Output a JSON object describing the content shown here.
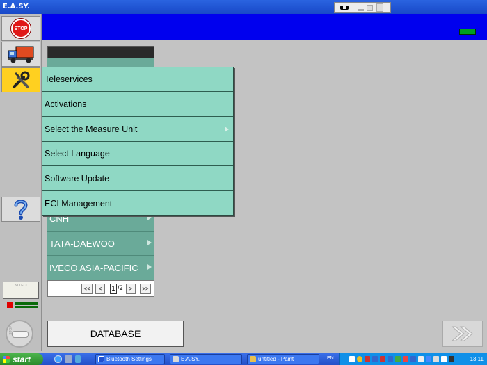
{
  "window": {
    "title": "E.A.SY."
  },
  "toolbar": {
    "stop_label": "STOP"
  },
  "menu": {
    "items": [
      {
        "label": "Teleservices",
        "submenu": false
      },
      {
        "label": "Activations",
        "submenu": false
      },
      {
        "label": "Select the Measure Unit",
        "submenu": true
      },
      {
        "label": "Select Language",
        "submenu": false
      },
      {
        "label": "Software Update",
        "submenu": false
      },
      {
        "label": "ECI Management",
        "submenu": false
      }
    ]
  },
  "brands": {
    "items": [
      {
        "label": "CNH"
      },
      {
        "label": "TATA-DAEWOO"
      },
      {
        "label": "IVECO ASIA-PACIFIC"
      }
    ]
  },
  "pager": {
    "first": "<<",
    "prev": "<",
    "current": "1",
    "total": "/2",
    "next": ">",
    "last": ">>"
  },
  "eci": {
    "label": "NO ECI"
  },
  "knob": {
    "label": "STOP"
  },
  "database": {
    "label": "DATABASE"
  },
  "taskbar": {
    "start_label": "start",
    "tasks": [
      {
        "label": "Bluetooth Settings"
      },
      {
        "label": "E.A.SY."
      },
      {
        "label": "untitled - Paint"
      }
    ],
    "language": "EN",
    "clock": "13:11"
  },
  "colors": {
    "header_blue": "#0000ee",
    "menu_teal": "#8fd8c4",
    "list_teal": "#6aaa99",
    "active_yellow": "#ffd020",
    "indicator_green": "#00a020"
  }
}
